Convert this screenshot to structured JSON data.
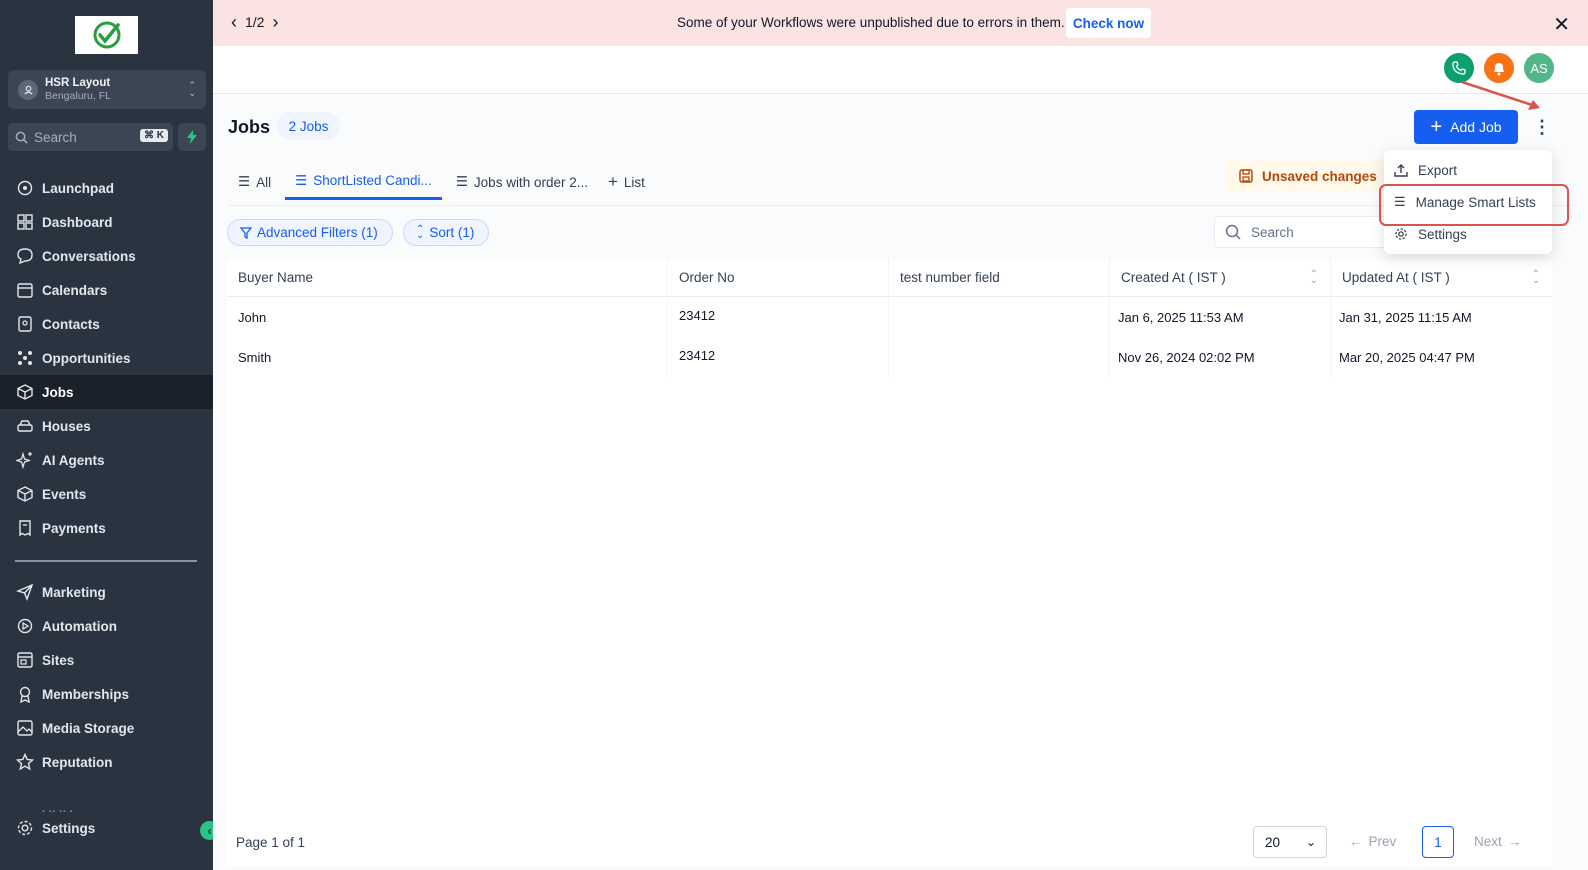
{
  "banner": {
    "pager": "1/2",
    "message": "Some of your Workflows were unpublished due to errors in them.",
    "cta": "Check now"
  },
  "sidebar": {
    "location_name": "HSR Layout",
    "location_sub": "Bengaluru, FL",
    "search_placeholder": "Search",
    "search_shortcut": "⌘ K",
    "items": [
      {
        "label": "Launchpad",
        "icon": "rocket-icon"
      },
      {
        "label": "Dashboard",
        "icon": "dashboard-icon"
      },
      {
        "label": "Conversations",
        "icon": "chat-icon"
      },
      {
        "label": "Calendars",
        "icon": "calendar-icon"
      },
      {
        "label": "Contacts",
        "icon": "contacts-icon"
      },
      {
        "label": "Opportunities",
        "icon": "opportunities-icon"
      },
      {
        "label": "Jobs",
        "icon": "cube-icon"
      },
      {
        "label": "Houses",
        "icon": "house-icon"
      },
      {
        "label": "AI Agents",
        "icon": "sparkle-icon"
      },
      {
        "label": "Events",
        "icon": "cube-icon"
      },
      {
        "label": "Payments",
        "icon": "receipt-icon"
      }
    ],
    "items2": [
      {
        "label": "Marketing",
        "icon": "send-icon"
      },
      {
        "label": "Automation",
        "icon": "automation-icon"
      },
      {
        "label": "Sites",
        "icon": "sites-icon"
      },
      {
        "label": "Memberships",
        "icon": "membership-icon"
      },
      {
        "label": "Media Storage",
        "icon": "media-icon"
      },
      {
        "label": "Reputation",
        "icon": "star-icon"
      }
    ],
    "settings_label": "Settings",
    "colors": {
      "bg": "#2a3340",
      "active": "#1a212b"
    }
  },
  "header": {
    "avatar_initials": "AS"
  },
  "page": {
    "title": "Jobs",
    "count_badge": "2 Jobs",
    "add_button": "Add Job",
    "tabs": [
      {
        "label": "All",
        "active": false
      },
      {
        "label": "ShortListed Candi...",
        "active": true
      },
      {
        "label": "Jobs with order 2...",
        "active": false
      },
      {
        "label": "List",
        "active": false
      }
    ],
    "unsaved": "Unsaved changes",
    "filter_chip": "Advanced Filters (1)",
    "sort_chip": "Sort (1)",
    "table_search_placeholder": "Search"
  },
  "table": {
    "columns": [
      "Buyer Name",
      "Order No",
      "test number field",
      "Created At ( IST )",
      "Updated At ( IST )"
    ],
    "rows": [
      [
        "John",
        "23412",
        "",
        "Jan 6, 2025 11:53 AM",
        "Jan 31, 2025 11:15 AM"
      ],
      [
        "Smith",
        "23412",
        "",
        "Nov 26, 2024 02:02 PM",
        "Mar 20, 2025 04:47 PM"
      ]
    ]
  },
  "footer": {
    "page_info": "Page 1 of 1",
    "per_page": "20",
    "prev": "Prev",
    "current_page": "1",
    "next": "Next"
  },
  "menu": {
    "items": [
      "Export",
      "Manage Smart Lists",
      "Settings"
    ]
  },
  "colors": {
    "primary": "#155eef",
    "banner_bg": "#fbe3e2",
    "highlight": "#d9534f",
    "phone": "#0e9f6e",
    "bell": "#f97316",
    "avatar": "#52b788"
  }
}
